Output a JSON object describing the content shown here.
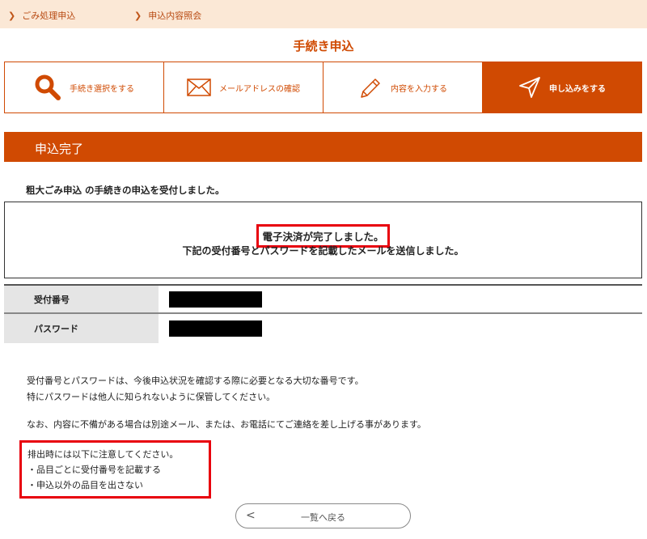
{
  "breadcrumb": {
    "items": [
      {
        "label": "ごみ処理申込",
        "chevron": "❯"
      },
      {
        "label": "申込内容照会",
        "chevron": "❯"
      }
    ]
  },
  "page_title": "手続き申込",
  "steps": [
    {
      "label": "手続き選択をする",
      "icon": "search-icon",
      "active": false
    },
    {
      "label": "メールアドレスの確認",
      "icon": "mail-icon",
      "active": false
    },
    {
      "label": "内容を入力する",
      "icon": "pencil-icon",
      "active": false
    },
    {
      "label": "申し込みをする",
      "icon": "send-icon",
      "active": true
    }
  ],
  "section_title": "申込完了",
  "accept_message": "粗大ごみ申込 の手続きの申込を受付しました。",
  "notice": {
    "line1": "電子決済が完了しました。",
    "line2": "下記の受付番号とパスワードを記載したメールを送信しました。"
  },
  "info": {
    "receipt_label": "受付番号",
    "password_label": "パスワード"
  },
  "paragraphs": {
    "p1_line1": "受付番号とパスワードは、今後申込状況を確認する際に必要となる大切な番号です。",
    "p1_line2": "特にパスワードは他人に知られないように保管してください。",
    "p2": "なお、内容に不備がある場合は別途メール、または、お電話にてご連絡を差し上げる事があります。"
  },
  "caution": {
    "title": "排出時には以下に注意してください。",
    "item1": "・品目ごとに受付番号を記載する",
    "item2": "・申込以外の品目を出さない"
  },
  "back_button": {
    "label": "一覧へ戻る",
    "arrow": "<"
  },
  "colors": {
    "accent": "#d04a02",
    "breadcrumb_bg": "#fbe8d6",
    "highlight": "#e8000d"
  }
}
